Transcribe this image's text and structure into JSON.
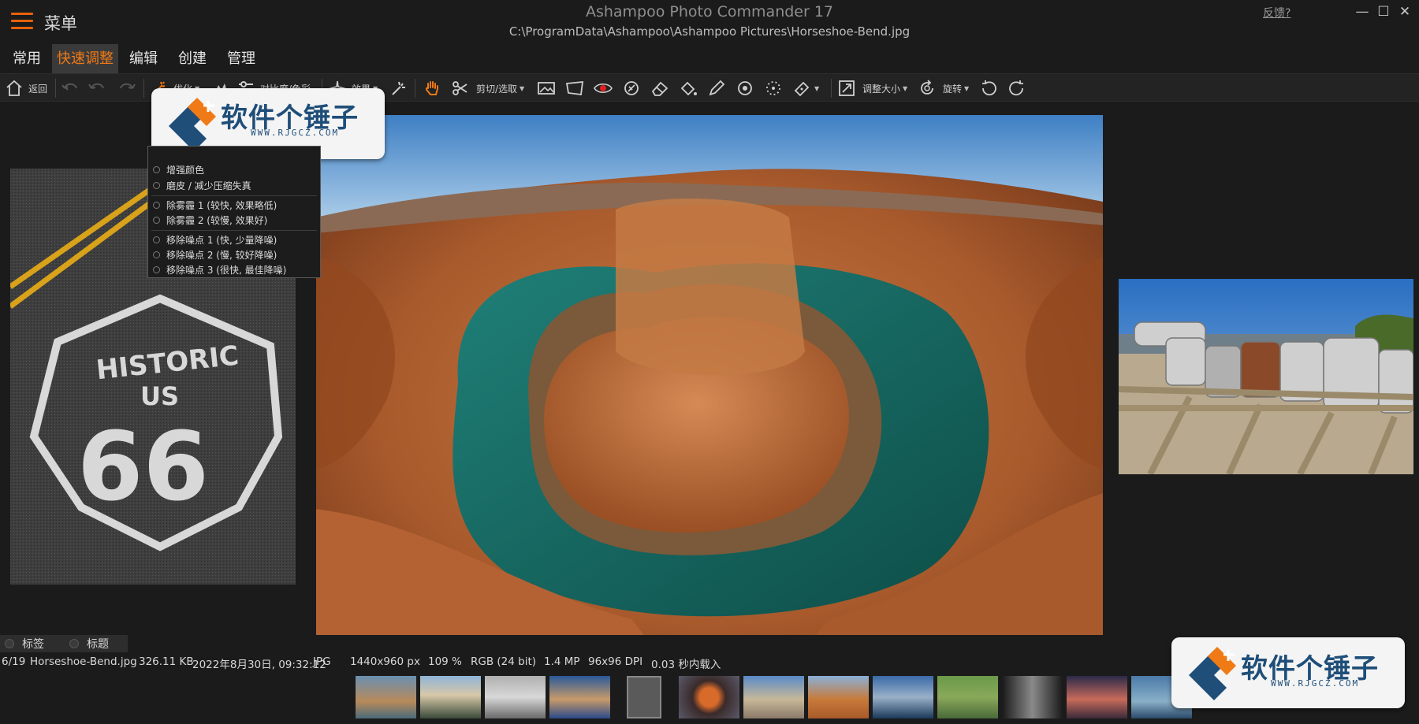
{
  "titlebar": {
    "menu_label": "菜单",
    "app_title": "Ashampoo Photo Commander 17",
    "file_path": "C:\\ProgramData\\Ashampoo\\Ashampoo Pictures\\Horseshoe-Bend.jpg",
    "feedback": "反馈?",
    "minimize": "—",
    "maximize": "☐",
    "close": "✕"
  },
  "ribbon": {
    "tabs": [
      {
        "label": "常用"
      },
      {
        "label": "快速调整"
      },
      {
        "label": "编辑"
      },
      {
        "label": "创建"
      },
      {
        "label": "管理"
      }
    ]
  },
  "toolbar": {
    "back_label": "返回",
    "optimize_label": "优化",
    "contrast_label": "对比度/色彩",
    "effects_label": "效果",
    "cut_label": "剪切/选取",
    "resize_label": "调整大小",
    "rotate_label": "旋转"
  },
  "optimize_menu": {
    "items": [
      {
        "label": "增强颜色"
      },
      {
        "label": "磨皮 / 减少压缩失真"
      },
      {
        "label": "除雾霾 1 (较快, 效果略低)"
      },
      {
        "label": "除雾霾 2 (较慢, 效果好)"
      },
      {
        "label": "移除噪点 1 (快, 少量降噪)"
      },
      {
        "label": "移除噪点 2 (慢, 较好降噪)"
      },
      {
        "label": "移除噪点 3 (很快, 最佳降噪)"
      }
    ]
  },
  "watermark": {
    "text": "软件个锤子",
    "url": "WWW.RJGCZ.COM"
  },
  "bottom_tabs": {
    "tags": "标签",
    "title": "标题"
  },
  "status": {
    "index": "6/19",
    "filename": "Horseshoe-Bend.jpg",
    "filesize": "326.11 KB",
    "datetime": "2022年8月30日, 09:32:12",
    "format": "JPG",
    "dimensions": "1440x960 px",
    "zoom": "109 %",
    "color_mode": "RGB (24 bit)",
    "megapixels": "1.4 MP",
    "dpi": "96x96 DPI",
    "load_time": "0.03 秒内载入"
  },
  "icons": {
    "home": "home-icon",
    "undo": "undo-icon",
    "hand": "hand-icon",
    "scissors": "scissors-icon",
    "rotate": "rotate-icon"
  },
  "colors": {
    "accent": "#f07a16",
    "background": "#1b1b1b",
    "toolbar": "#232323",
    "active_tab": "#3a3a3a"
  }
}
